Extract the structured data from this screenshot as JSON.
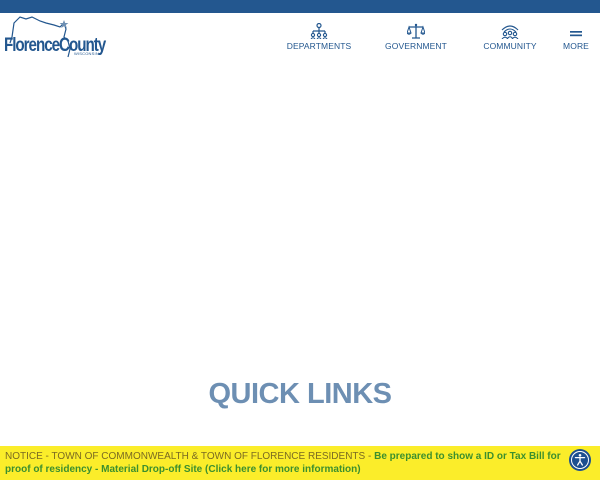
{
  "brand": {
    "logo_text": "FlorenceCounty",
    "logo_subtext": "WISCONSIN",
    "primary_color": "#23578f",
    "accent_color": "#6d8fb3"
  },
  "nav": {
    "items": [
      {
        "label": "DEPARTMENTS",
        "icon": "departments-org-chart-icon"
      },
      {
        "label": "GOVERNMENT",
        "icon": "scales-of-justice-icon"
      },
      {
        "label": "COMMUNITY",
        "icon": "community-people-icon"
      },
      {
        "label": "MORE",
        "icon": "hamburger-menu-icon"
      }
    ]
  },
  "main": {
    "quick_links_heading": "QUICK LINKS"
  },
  "notice": {
    "prefix": "NOTICE - TOWN OF COMMONWEALTH & TOWN OF FLORENCE RESIDENTS - ",
    "link_text": "Be prepared to show a ID or Tax Bill for proof of residency - Material Drop-off Site (Click here for more information)",
    "background_color": "#fbed2a"
  },
  "accessibility": {
    "icon": "accessibility-person-icon"
  }
}
